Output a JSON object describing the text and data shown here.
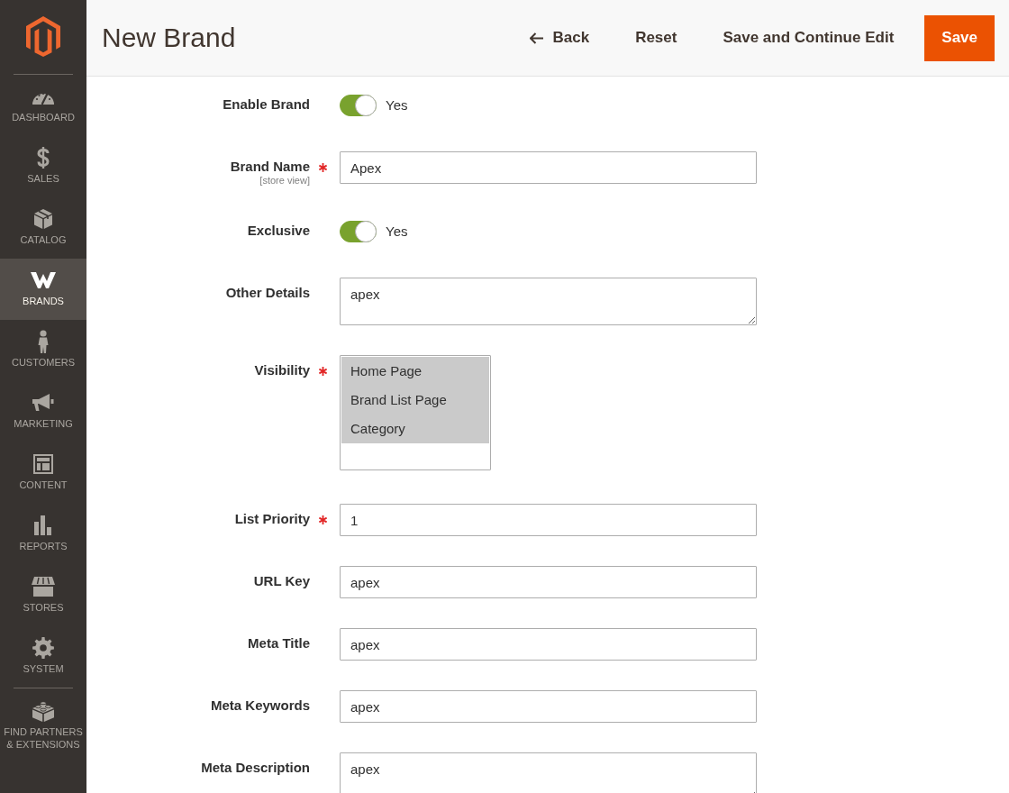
{
  "sidebar": {
    "items": [
      {
        "label": "DASHBOARD",
        "selected": false
      },
      {
        "label": "SALES",
        "selected": false
      },
      {
        "label": "CATALOG",
        "selected": false
      },
      {
        "label": "BRANDS",
        "selected": true
      },
      {
        "label": "CUSTOMERS",
        "selected": false
      },
      {
        "label": "MARKETING",
        "selected": false
      },
      {
        "label": "CONTENT",
        "selected": false
      },
      {
        "label": "REPORTS",
        "selected": false
      },
      {
        "label": "STORES",
        "selected": false
      },
      {
        "label": "SYSTEM",
        "selected": false
      }
    ],
    "partners": {
      "label": "FIND PARTNERS & EXTENSIONS"
    }
  },
  "header": {
    "title": "New Brand",
    "actions": [
      {
        "kind": "back",
        "label": "Back"
      },
      {
        "kind": "link",
        "label": "Reset"
      },
      {
        "kind": "link",
        "label": "Save and Continue Edit"
      },
      {
        "kind": "primary",
        "label": "Save"
      }
    ]
  },
  "form": {
    "fields": [
      {
        "kind": "toggle",
        "label": "Enable Brand",
        "required": false,
        "on": true,
        "value": "Yes"
      },
      {
        "kind": "text",
        "label": "Brand Name",
        "required": true,
        "scope": "[store view]",
        "value": "Apex"
      },
      {
        "kind": "toggle",
        "label": "Exclusive",
        "required": false,
        "on": true,
        "value": "Yes"
      },
      {
        "kind": "textarea",
        "label": "Other Details",
        "required": false,
        "value": "apex"
      },
      {
        "kind": "multiselect",
        "label": "Visibility",
        "required": true,
        "options": [
          {
            "label": "Home Page",
            "selected": true
          },
          {
            "label": "Brand List Page",
            "selected": true
          },
          {
            "label": "Category",
            "selected": true
          }
        ]
      },
      {
        "kind": "text",
        "label": "List Priority",
        "required": true,
        "value": "1"
      },
      {
        "kind": "text",
        "label": "URL Key",
        "required": false,
        "value": "apex"
      },
      {
        "kind": "text",
        "label": "Meta Title",
        "required": false,
        "value": "apex"
      },
      {
        "kind": "text",
        "label": "Meta Keywords",
        "required": false,
        "value": "apex"
      },
      {
        "kind": "textarea",
        "label": "Meta Description",
        "required": false,
        "value": "apex"
      }
    ]
  }
}
